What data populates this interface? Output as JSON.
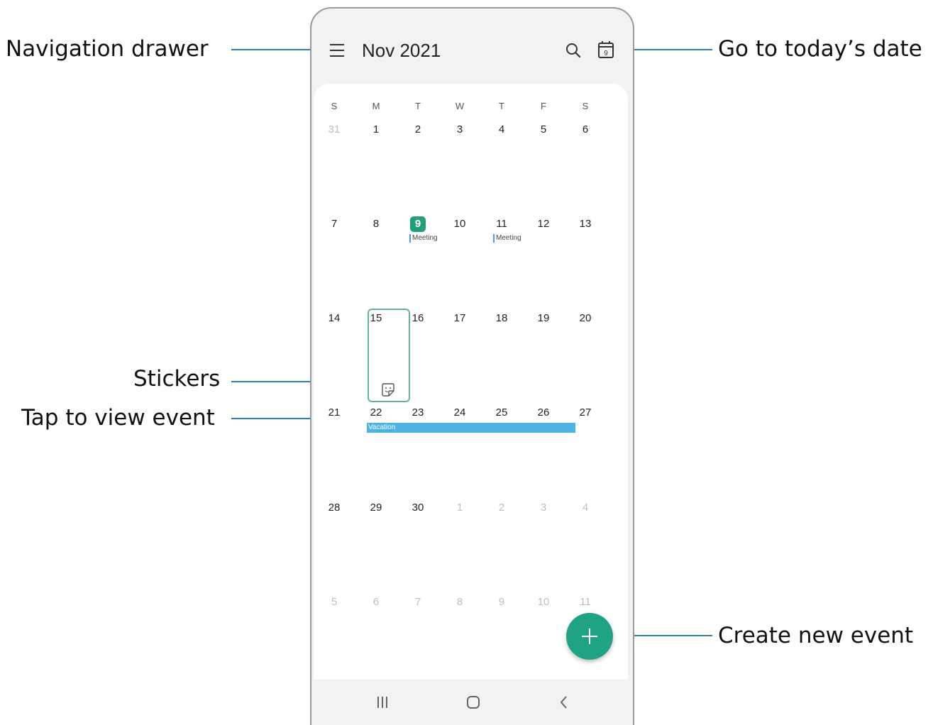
{
  "header": {
    "title": "Nov  2021",
    "today_icon_day": "9"
  },
  "callouts": {
    "navigation_drawer": "Navigation drawer",
    "today": "Go to today’s date",
    "stickers": "Stickers",
    "view_event": "Tap to view event",
    "create_event": "Create new event"
  },
  "calendar": {
    "weekdays": [
      "S",
      "M",
      "T",
      "W",
      "T",
      "F",
      "S"
    ],
    "weeks": [
      [
        "31",
        "1",
        "2",
        "3",
        "4",
        "5",
        "6"
      ],
      [
        "7",
        "8",
        "9",
        "10",
        "11",
        "12",
        "13"
      ],
      [
        "14",
        "15",
        "16",
        "17",
        "18",
        "19",
        "20"
      ],
      [
        "21",
        "22",
        "23",
        "24",
        "25",
        "26",
        "27"
      ],
      [
        "28",
        "29",
        "30",
        "1",
        "2",
        "3",
        "4"
      ],
      [
        "5",
        "6",
        "7",
        "8",
        "9",
        "10",
        "11"
      ]
    ],
    "events": {
      "meeting_9": "Meeting",
      "meeting_11": "Meeting",
      "vacation": "Vacation"
    }
  },
  "icons": {
    "menu": "menu-icon",
    "search": "search-icon",
    "today": "calendar-today-icon",
    "sticker": "sticker-icon",
    "fab": "plus-icon",
    "recent": "recent-apps-icon",
    "home": "home-icon",
    "back": "back-icon"
  },
  "colors": {
    "accent": "#23a07a",
    "event": "#4db3e4",
    "callout_line": "#2d7fb8"
  }
}
